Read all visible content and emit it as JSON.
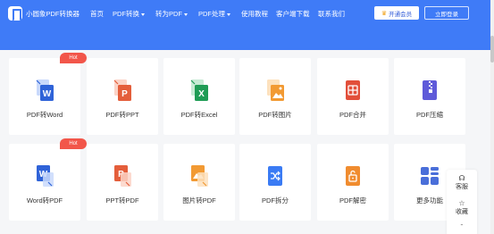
{
  "colors": {
    "brand": "#3f7bf7",
    "hot": "#f2564a",
    "word": "#2f63d8",
    "ppt": "#e45e3b",
    "excel": "#1f9c55",
    "image": "#f29a33",
    "pdf": "#e24f3a",
    "compress": "#5f5ad9",
    "split": "#3a7bf4",
    "unlock": "#f08c2f",
    "more": "#4a6fd9"
  },
  "header": {
    "brand": "小圆象PDF转换器",
    "nav": [
      {
        "label": "首页",
        "dropdown": false
      },
      {
        "label": "PDF转换",
        "dropdown": true
      },
      {
        "label": "转为PDF",
        "dropdown": true
      },
      {
        "label": "PDF处理",
        "dropdown": true
      },
      {
        "label": "使用教程",
        "dropdown": false
      },
      {
        "label": "客户端下载",
        "dropdown": false
      },
      {
        "label": "联系我们",
        "dropdown": false
      }
    ],
    "vip_label": "开通会员",
    "login_label": "立即登录"
  },
  "tools": [
    {
      "label": "PDF转Word",
      "badge": "Hot",
      "icon": "pdf-to-word-icon"
    },
    {
      "label": "PDF转PPT",
      "badge": "",
      "icon": "pdf-to-ppt-icon"
    },
    {
      "label": "PDF转Excel",
      "badge": "",
      "icon": "pdf-to-excel-icon"
    },
    {
      "label": "PDF转图片",
      "badge": "",
      "icon": "pdf-to-image-icon"
    },
    {
      "label": "PDF合并",
      "badge": "",
      "icon": "pdf-merge-icon"
    },
    {
      "label": "PDF压缩",
      "badge": "",
      "icon": "pdf-compress-icon"
    },
    {
      "label": "Word转PDF",
      "badge": "Hot",
      "icon": "word-to-pdf-icon"
    },
    {
      "label": "PPT转PDF",
      "badge": "",
      "icon": "ppt-to-pdf-icon"
    },
    {
      "label": "图片转PDF",
      "badge": "",
      "icon": "image-to-pdf-icon"
    },
    {
      "label": "PDF拆分",
      "badge": "",
      "icon": "pdf-split-icon"
    },
    {
      "label": "PDF解密",
      "badge": "",
      "icon": "pdf-unlock-icon"
    },
    {
      "label": "更多功能",
      "badge": "",
      "icon": "more-tools-icon"
    }
  ],
  "side": {
    "service_label": "客服",
    "favorite_label": "收藏"
  }
}
